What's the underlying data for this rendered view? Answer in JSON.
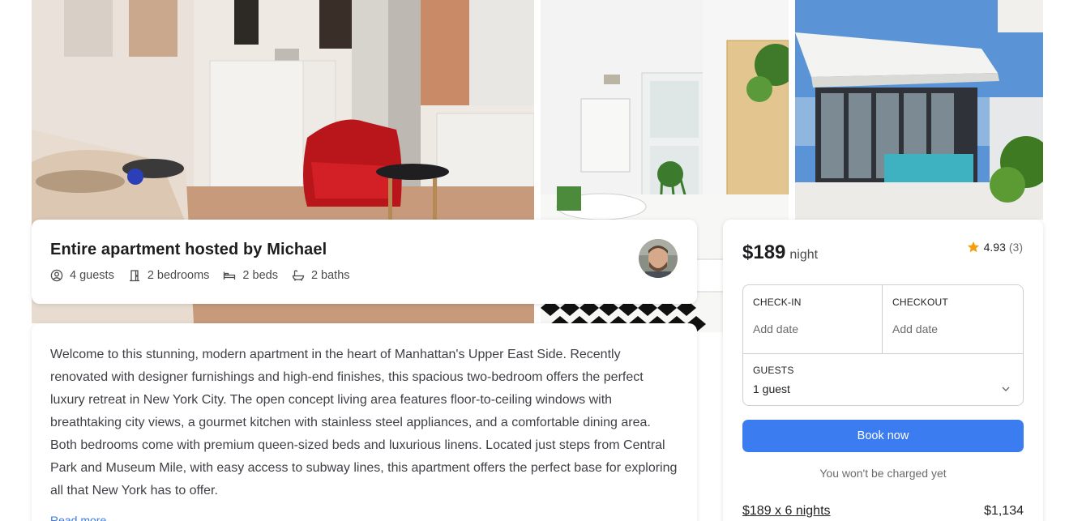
{
  "listing": {
    "host_title": "Entire apartment hosted by Michael",
    "features": [
      {
        "icon": "user-circle-icon",
        "label": "4 guests"
      },
      {
        "icon": "door-icon",
        "label": "2 bedrooms"
      },
      {
        "icon": "bed-icon",
        "label": "2 beds"
      },
      {
        "icon": "bath-icon",
        "label": "2 baths"
      }
    ],
    "description": "Welcome to this stunning, modern apartment in the heart of Manhattan's Upper East Side. Recently renovated with designer furnishings and high-end finishes, this spacious two-bedroom offers the perfect luxury retreat in New York City. The open concept living area features floor-to-ceiling windows with breathtaking city views, a gourmet kitchen with stainless steel appliances, and a comfortable dining area. Both bedrooms come with premium queen-sized beds and luxurious linens. Located just steps from Central Park and Museum Mile, with easy access to subway lines, this apartment offers the perfect base for exploring all that New York has to offer.",
    "read_more": "Read more"
  },
  "booking": {
    "price": "$189",
    "price_unit": "night",
    "rating": "4.93",
    "review_count": "(3)",
    "checkin_label": "CHECK-IN",
    "checkin_placeholder": "Add date",
    "checkout_label": "CHECKOUT",
    "checkout_placeholder": "Add date",
    "guests_label": "GUESTS",
    "guests_value": "1 guest",
    "book_label": "Book now",
    "charge_note": "You won't be charged yet",
    "nights_line": "$189 x 6 nights",
    "nights_total": "$1,134"
  },
  "colors": {
    "accent": "#3b7cf0",
    "star": "#f59e0b",
    "link": "#3b7ae0"
  }
}
